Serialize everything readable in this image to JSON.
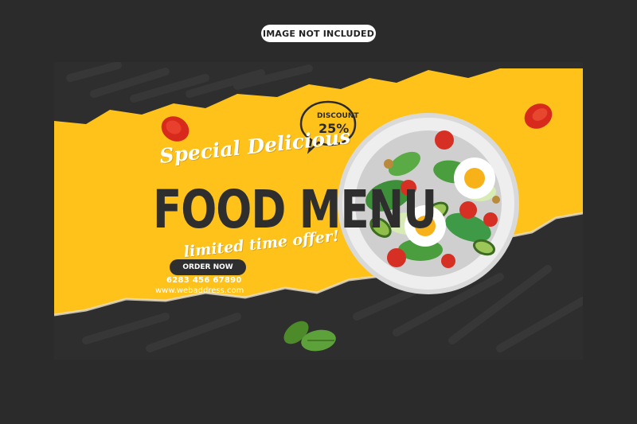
{
  "top_badge": "IMAGE NOT INCLUDED",
  "banner": {
    "headline_script_1": "Special Delicious",
    "headline_main": "FOOD MENU",
    "headline_script_2": "limited time offer!",
    "cta_label": "ORDER NOW",
    "phone": "6283 456 67890",
    "website": "www.webaddress.com"
  },
  "discount": {
    "label": "DISCOUNT",
    "value": "25%"
  },
  "colors": {
    "accent_yellow": "#ffc21a",
    "dark": "#2e2e2e",
    "page_bg": "#2b2b2b"
  }
}
